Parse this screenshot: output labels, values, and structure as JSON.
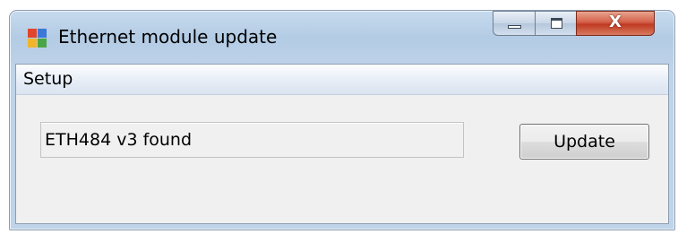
{
  "window": {
    "title": "Ethernet module update",
    "app_icon": "windows-form-icon",
    "controls": {
      "minimize_icon": "minimize-icon",
      "maximize_icon": "maximize-icon",
      "close_label": "X"
    }
  },
  "menu": {
    "items": [
      {
        "label": "Setup"
      }
    ]
  },
  "main": {
    "status_text": "ETH484 v3 found",
    "update_label": "Update"
  },
  "colors": {
    "close_button": "#c03a22",
    "titlebar": "#b3cbe4",
    "client_background": "#f0f0f0"
  }
}
